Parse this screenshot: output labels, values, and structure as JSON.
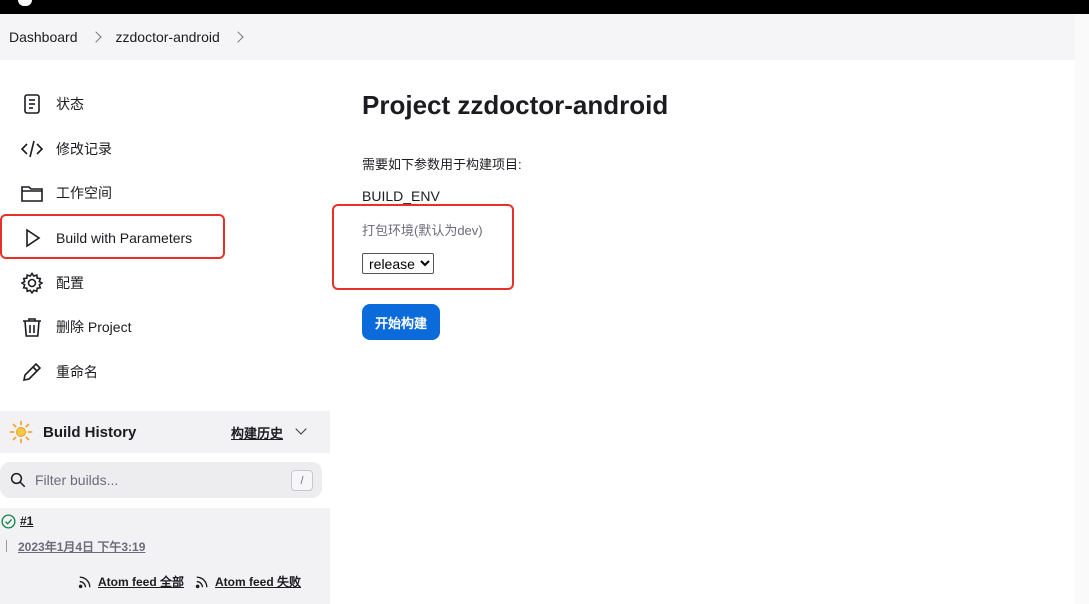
{
  "breadcrumbs": {
    "items": [
      "Dashboard",
      "zzdoctor-android"
    ]
  },
  "sidebar": {
    "tasks": [
      {
        "label": "状态",
        "icon": "document-icon"
      },
      {
        "label": "修改记录",
        "icon": "code-icon"
      },
      {
        "label": "工作空间",
        "icon": "folder-icon"
      },
      {
        "label": "Build with Parameters",
        "icon": "play-icon"
      },
      {
        "label": "配置",
        "icon": "gear-icon"
      },
      {
        "label": "删除 Project",
        "icon": "trash-icon"
      },
      {
        "label": "重命名",
        "icon": "pencil-icon"
      }
    ],
    "build_history": {
      "title": "Build History",
      "trend_link": "构建历史",
      "filter_placeholder": "Filter builds...",
      "filter_shortcut": "/",
      "builds": [
        {
          "number": "#1",
          "time": "2023年1月4日 下午3:19",
          "status": "success"
        }
      ],
      "feeds": [
        {
          "label": "Atom feed 全部"
        },
        {
          "label": "Atom feed 失败"
        }
      ]
    }
  },
  "main": {
    "title": "Project zzdoctor-android",
    "description": "需要如下参数用于构建项目:",
    "parameter": {
      "name": "BUILD_ENV",
      "description": "打包环境(默认为dev)",
      "selected_value": "release"
    },
    "build_button": "开始构建"
  },
  "colors": {
    "accent": "#0b6bdb",
    "highlight": "#e8302a",
    "success": "#138347"
  }
}
